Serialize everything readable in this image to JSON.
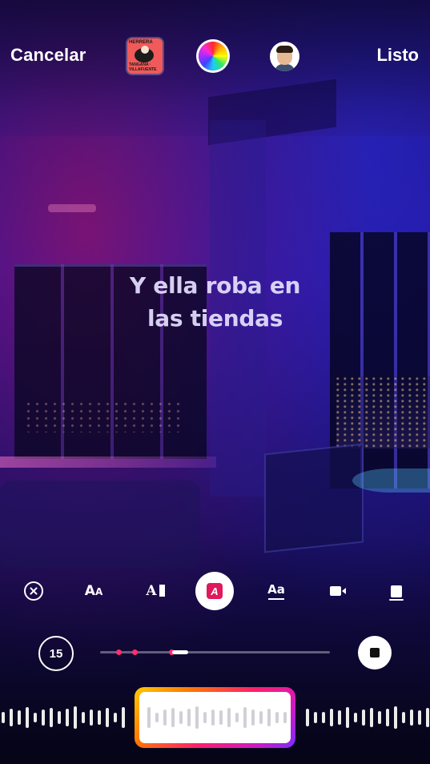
{
  "topbar": {
    "cancel_label": "Cancelar",
    "done_label": "Listo",
    "album_cover": {
      "line1": "HERRERA",
      "line2": "TANGANA · VILLAFUENTE"
    }
  },
  "lyric": {
    "line1": "Y ella roba en",
    "line2": "las tiendas"
  },
  "toolbar": {
    "tools": [
      "remove-lyrics",
      "text-size",
      "typewriter-text",
      "highlight-text",
      "underline-text",
      "video-effect",
      "card-style"
    ],
    "active": "highlight-text",
    "accent_color": "#e0195c",
    "labels": {
      "aa": "Aa",
      "ai": "A",
      "a": "A"
    }
  },
  "playback": {
    "duration_label": "15",
    "position_fraction": 0.35
  },
  "colors": {
    "accent_pink": "#ff2f6e",
    "background_blue": "#25129a",
    "background_magenta": "#be145a"
  }
}
